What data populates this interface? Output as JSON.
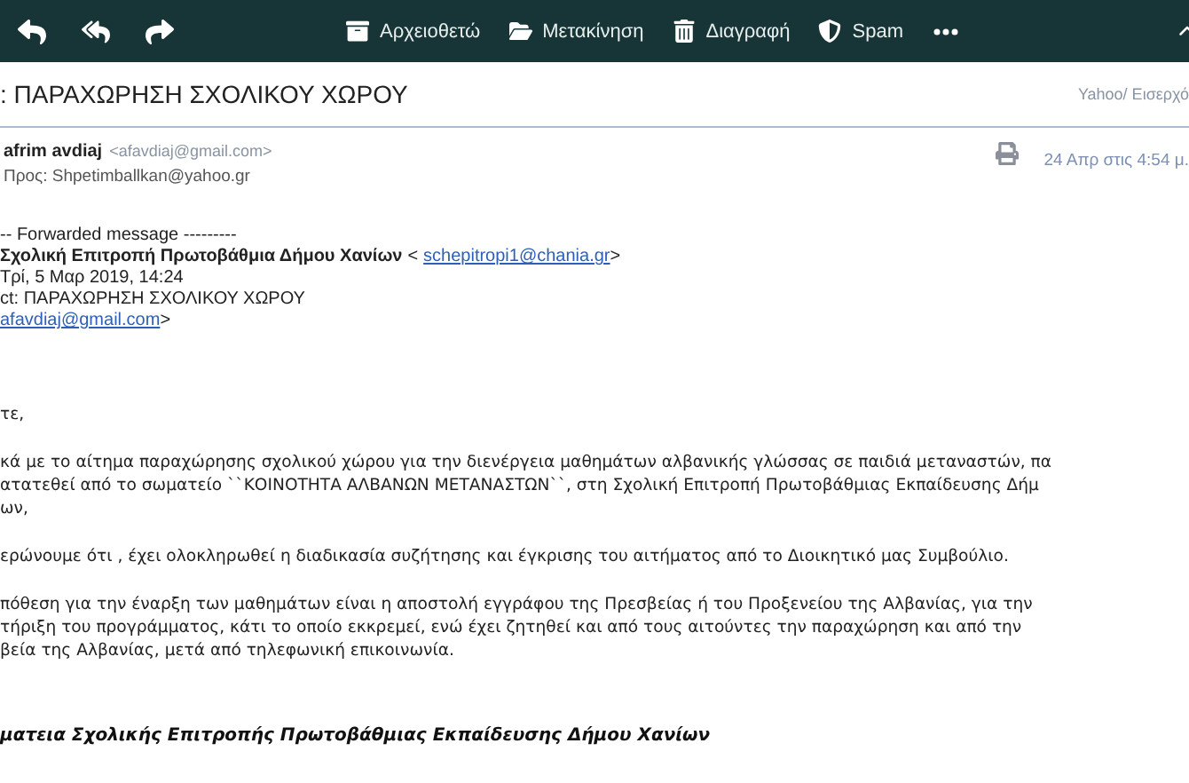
{
  "toolbar": {
    "nav": [
      {
        "kind": "reply"
      },
      {
        "kind": "reply-all"
      },
      {
        "kind": "forward"
      }
    ],
    "actions": [
      {
        "kind": "archive",
        "label": "Αρχειοθετώ"
      },
      {
        "kind": "move",
        "label": "Μετακίνηση"
      },
      {
        "kind": "delete",
        "label": "Διαγραφή"
      },
      {
        "kind": "spam",
        "label": "Spam"
      }
    ]
  },
  "subject": ": ΠΑΡΑΧΩΡΗΣΗ ΣΧΟΛΙΚΟΥ ΧΩΡΟΥ",
  "folder": "Yahoo/ Εισερχό",
  "sender": {
    "name": "afrim avdiaj",
    "email": "<afavdiaj@gmail.com>",
    "to": "Προς: Shpetimballkan@yahoo.gr",
    "date": "24 Απρ στις 4:54 μ."
  },
  "forwarded": {
    "header": "-- Forwarded message ---------",
    "from_name": "Σχολική Επιτροπή Πρωτοβάθμια Δήμου Χανίων",
    "open": "<",
    "from_email": "schepitropi1@chania.gr",
    "close": ">",
    "date": "Τρί, 5 Μαρ 2019, 14:24",
    "subject": "ct: ΠΑΡΑΧΩΡΗΣΗ ΣΧΟΛΙΚΟΥ ΧΩΡΟΥ",
    "to_email": "afavdiaj@gmail.com",
    "to_close": ">"
  },
  "body": [
    [
      "τε,"
    ],
    [
      "κά με το αίτημα παραχώρησης σχολικού χώρου για την διενέργεια μαθημάτων αλβανικής γλώσσας σε παιδιά μεταναστών, πα",
      "ατατεθεί από το σωματείο ``ΚΟΙΝΟΤΗΤΑ ΑΛΒΑΝΩΝ ΜΕΤΑΝΑΣΤΩΝ``, στη Σχολική Επιτροπή Πρωτοβάθμιας Εκπαίδευσης Δήμ",
      "ων,"
    ],
    [
      "ερώνουμε ότι , έχει ολοκληρωθεί η διαδικασία συζήτησης και έγκρισης του αιτήματος από το Διοικητικό μας Συμβούλιο."
    ],
    [
      "πόθεση για την έναρξη των μαθημάτων είναι η αποστολή εγγράφου της Πρεσβείας ή του Προξενείου της Αλβανίας, για την",
      "τήριξη του προγράμματος, κάτι το οποίο εκκρεμεί, ενώ έχει ζητηθεί και από τους αιτούντες την παραχώρηση και από την",
      "βεία της Αλβανίας, μετά από τηλεφωνική επικοινωνία."
    ]
  ],
  "signature": "ματεια Σχολικής Επιτροπής Πρωτοβάθμιας Εκπαίδευσης Δήμου Χανίων"
}
